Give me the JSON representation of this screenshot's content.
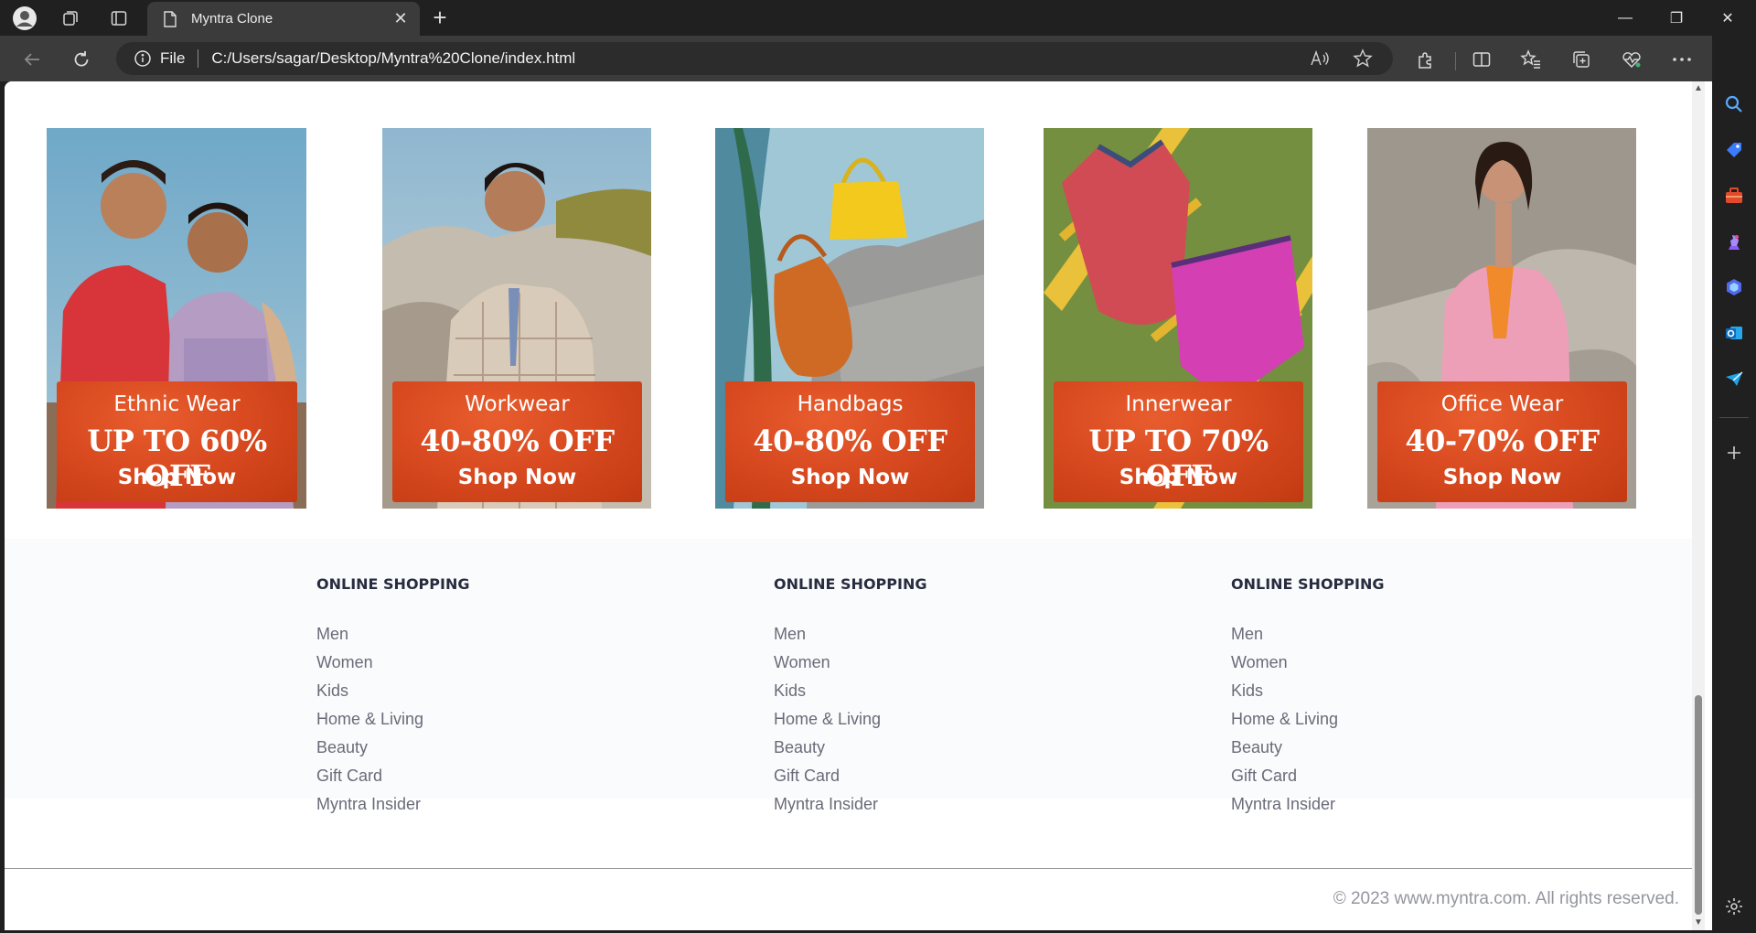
{
  "browser": {
    "tab_title": "Myntra Clone",
    "address_label": "File",
    "url": "C:/Users/sagar/Desktop/Myntra%20Clone/index.html",
    "new_tab": "+",
    "tab_close": "✕",
    "minimize": "—",
    "restore": "❐",
    "close": "✕"
  },
  "banners": [
    {
      "category": "Ethnic Wear",
      "deal": "UP TO 60% OFF",
      "cta": "Shop Now"
    },
    {
      "category": "Workwear",
      "deal": "40-80% OFF",
      "cta": "Shop Now"
    },
    {
      "category": "Handbags",
      "deal": "40-80% OFF",
      "cta": "Shop Now"
    },
    {
      "category": "Innerwear",
      "deal": "UP TO 70% OFF",
      "cta": "Shop Now"
    },
    {
      "category": "Office Wear",
      "deal": "40-70% OFF",
      "cta": "Shop Now"
    }
  ],
  "footer": {
    "columns": [
      {
        "heading": "ONLINE SHOPPING",
        "links": [
          "Men",
          "Women",
          "Kids",
          "Home & Living",
          "Beauty",
          "Gift Card",
          "Myntra Insider"
        ]
      },
      {
        "heading": "ONLINE SHOPPING",
        "links": [
          "Men",
          "Women",
          "Kids",
          "Home & Living",
          "Beauty",
          "Gift Card",
          "Myntra Insider"
        ]
      },
      {
        "heading": "ONLINE SHOPPING",
        "links": [
          "Men",
          "Women",
          "Kids",
          "Home & Living",
          "Beauty",
          "Gift Card",
          "Myntra Insider"
        ]
      }
    ],
    "copyright": "© 2023 www.myntra.com. All rights reserved."
  },
  "icons": {
    "profile": "profile-icon",
    "workspaces": "workspaces-icon",
    "tab-actions": "tab-actions-icon",
    "back": "back-icon",
    "refresh": "refresh-icon",
    "info": "info-icon",
    "read-aloud": "read-aloud-icon",
    "favorite": "star-icon",
    "extensions": "extensions-icon",
    "split": "split-screen-icon",
    "favorites": "favorites-icon",
    "collections": "collections-icon",
    "health": "browser-essentials-icon",
    "more": "more-icon",
    "copilot": "copilot-icon"
  },
  "colors": {
    "offer_red": "#d94a20",
    "footer_heading": "#282c3f",
    "footer_link": "#696b79"
  }
}
